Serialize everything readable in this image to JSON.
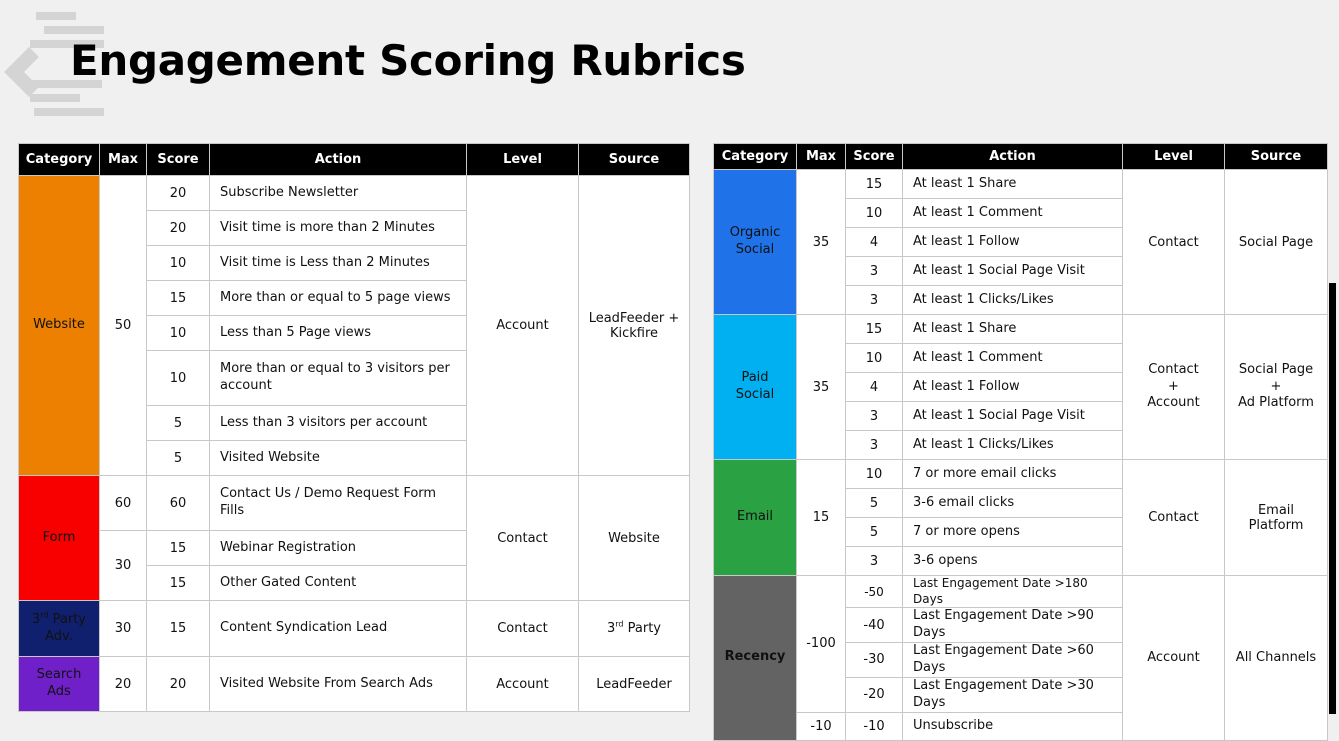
{
  "title": "Engagement Scoring Rubrics",
  "headers": {
    "category": "Category",
    "max": "Max",
    "score": "Score",
    "action": "Action",
    "level": "Level",
    "source": "Source"
  },
  "left": {
    "website": {
      "category": "Website",
      "max": "50",
      "level": "Account",
      "source": "LeadFeeder + Kickfire",
      "rows": [
        {
          "score": "20",
          "action": "Subscribe Newsletter"
        },
        {
          "score": "20",
          "action": "Visit time is more than 2 Minutes"
        },
        {
          "score": "10",
          "action": "Visit time is Less than 2 Minutes"
        },
        {
          "score": "15",
          "action": "More than or equal to 5 page views"
        },
        {
          "score": "10",
          "action": "Less than 5 Page views"
        },
        {
          "score": "10",
          "action": "More than or equal to 3 visitors per account"
        },
        {
          "score": "5",
          "action": "Less than 3 visitors per account"
        },
        {
          "score": "5",
          "action": "Visited Website"
        }
      ]
    },
    "form": {
      "category": "Form",
      "max_1": "60",
      "max_2": "30",
      "level": "Contact",
      "source": "Website",
      "rows": [
        {
          "score": "60",
          "action": "Contact Us / Demo Request Form Fills"
        },
        {
          "score": "15",
          "action": "Webinar Registration"
        },
        {
          "score": "15",
          "action": "Other Gated Content"
        }
      ]
    },
    "third_party": {
      "category_num": "3",
      "category_sup": "rd",
      "category_rest": " Party Adv.",
      "max": "30",
      "score": "15",
      "action": "Content Syndication Lead",
      "level": "Contact",
      "source_num": "3",
      "source_sup": "rd",
      "source_rest": " Party"
    },
    "search_ads": {
      "category": "Search Ads",
      "max": "20",
      "score": "20",
      "action": "Visited Website From Search Ads",
      "level": "Account",
      "source": "LeadFeeder"
    }
  },
  "right": {
    "organic": {
      "category": "Organic Social",
      "max": "35",
      "level": "Contact",
      "source": "Social Page",
      "rows": [
        {
          "score": "15",
          "action": "At least 1 Share"
        },
        {
          "score": "10",
          "action": "At least 1 Comment"
        },
        {
          "score": "4",
          "action": "At least 1 Follow"
        },
        {
          "score": "3",
          "action": "At least 1 Social Page Visit"
        },
        {
          "score": "3",
          "action": "At least 1 Clicks/Likes"
        }
      ]
    },
    "paid": {
      "category": "Paid Social",
      "max": "35",
      "level_1": "Contact",
      "level_plus": "+",
      "level_2": "Account",
      "source_1": "Social Page",
      "source_plus": "+",
      "source_2": "Ad Platform",
      "rows": [
        {
          "score": "15",
          "action": "At least 1 Share"
        },
        {
          "score": "10",
          "action": "At least 1 Comment"
        },
        {
          "score": "4",
          "action": "At least 1 Follow"
        },
        {
          "score": "3",
          "action": "At least 1 Social Page Visit"
        },
        {
          "score": "3",
          "action": "At least 1 Clicks/Likes"
        }
      ]
    },
    "email": {
      "category": "Email",
      "max": "15",
      "level": "Contact",
      "source": "Email Platform",
      "rows": [
        {
          "score": "10",
          "action": "7 or more email clicks"
        },
        {
          "score": "5",
          "action": "3-6 email clicks"
        },
        {
          "score": "5",
          "action": "7 or more opens"
        },
        {
          "score": "3",
          "action": "3-6 opens"
        }
      ]
    },
    "recency": {
      "category": "Recency",
      "max_1": "-100",
      "max_2": "-10",
      "level": "Account",
      "source": "All Channels",
      "rows": [
        {
          "score": "-50",
          "action": "Last Engagement Date >180 Days"
        },
        {
          "score": "-40",
          "action": "Last Engagement Date >90 Days"
        },
        {
          "score": "-30",
          "action": "Last Engagement Date >60 Days"
        },
        {
          "score": "-20",
          "action": "Last Engagement Date >30 Days"
        },
        {
          "score": "-10",
          "action": "Unsubscribe"
        }
      ]
    }
  },
  "colors": {
    "website": "#ed8000",
    "form": "#f80000",
    "third_party": "#10206e",
    "search_ads": "#7020c8",
    "organic": "#1f72e8",
    "paid": "#00b0f0",
    "email": "#2aa244",
    "recency": "#636363",
    "header": "#000000",
    "logo": "#d4d4d4"
  }
}
